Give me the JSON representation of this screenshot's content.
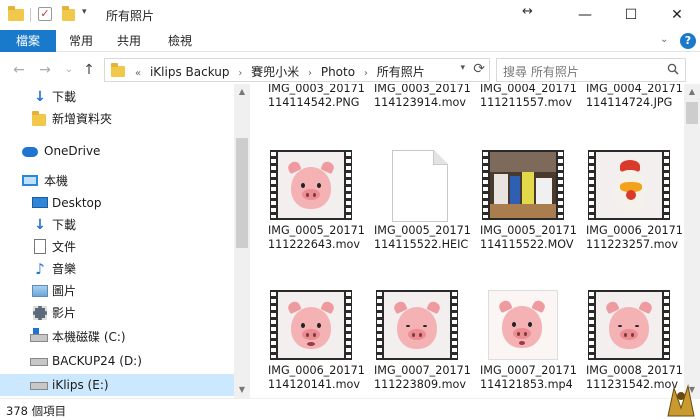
{
  "titlebar": {
    "title": "所有照片",
    "minimize": "—",
    "maximize": "☐",
    "close": "✕",
    "resize_glyph": "↔"
  },
  "ribbon": {
    "tabs": [
      "檔案",
      "常用",
      "共用",
      "檢視"
    ],
    "collapse_glyph": "⌄",
    "help_glyph": "?"
  },
  "address": {
    "crumbs": [
      "«",
      "iKlips Backup",
      "›",
      "賽兜小米",
      "›",
      "Photo",
      "›",
      "所有照片"
    ],
    "dropdown_glyph": "▾",
    "refresh_glyph": "⟳",
    "back_glyph": "←",
    "forward_glyph": "→",
    "recent_glyph": "⌄",
    "up_glyph": "↑"
  },
  "search": {
    "placeholder": "搜尋 所有照片"
  },
  "sidebar": {
    "items": [
      {
        "label": "下載",
        "icon": "download-icon"
      },
      {
        "label": "新增資料夾",
        "icon": "folder-icon"
      },
      {
        "label": "OneDrive",
        "icon": "onedrive-icon"
      },
      {
        "label": "本機",
        "icon": "this-pc-icon"
      },
      {
        "label": "Desktop",
        "icon": "desktop-icon"
      },
      {
        "label": "下載",
        "icon": "download-icon"
      },
      {
        "label": "文件",
        "icon": "documents-icon"
      },
      {
        "label": "音樂",
        "icon": "music-icon"
      },
      {
        "label": "圖片",
        "icon": "pictures-icon"
      },
      {
        "label": "影片",
        "icon": "videos-icon"
      },
      {
        "label": "本機磁碟 (C:)",
        "icon": "local-disk-icon"
      },
      {
        "label": "BACKUP24 (D:)",
        "icon": "drive-icon"
      },
      {
        "label": "iKlips (E:)",
        "icon": "drive-icon"
      }
    ],
    "selected_index": 12
  },
  "files": [
    {
      "name": "IMG_0003_20171114114542.PNG",
      "thumb": "none"
    },
    {
      "name": "IMG_0003_20171114123914.mov",
      "thumb": "none"
    },
    {
      "name": "IMG_0004_20171111211557.mov",
      "thumb": "none"
    },
    {
      "name": "IMG_0004_20171114114724.JPG",
      "thumb": "none"
    },
    {
      "name": "IMG_0005_20171111222643.mov",
      "thumb": "pig-video"
    },
    {
      "name": "IMG_0005_20171114115522.HEIC",
      "thumb": "blank-file"
    },
    {
      "name": "IMG_0005_20171114115522.MOV",
      "thumb": "desk-video"
    },
    {
      "name": "IMG_0006_20171111223257.mov",
      "thumb": "rooster-video"
    },
    {
      "name": "IMG_0006_20171114120141.mov",
      "thumb": "pig-video"
    },
    {
      "name": "IMG_0007_20171111223809.mov",
      "thumb": "pig-video"
    },
    {
      "name": "IMG_0007_20171114121853.mp4",
      "thumb": "pig-image"
    },
    {
      "name": "IMG_0008_20171111231542.mov",
      "thumb": "pig-video"
    }
  ],
  "status": {
    "item_count": "378 個項目"
  }
}
